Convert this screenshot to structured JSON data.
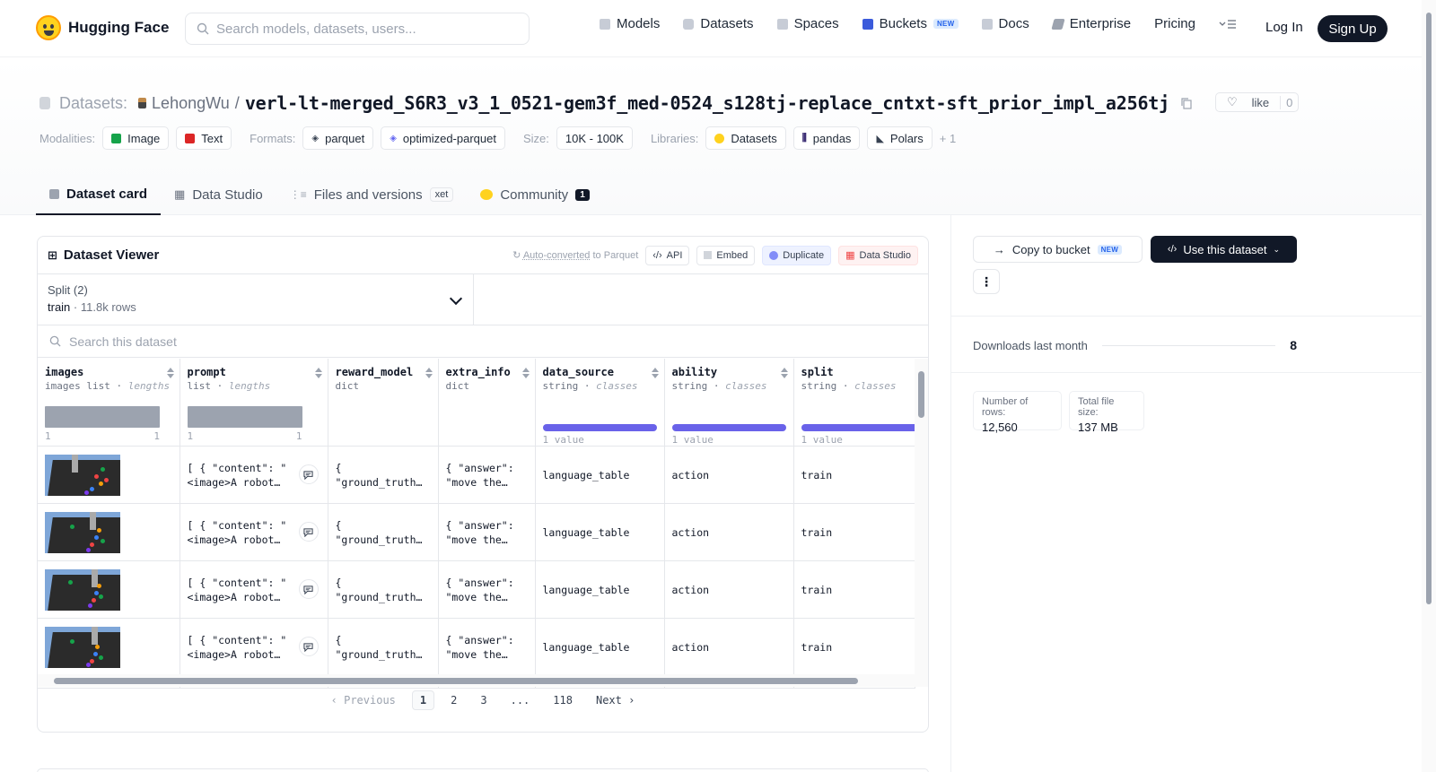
{
  "nav": {
    "brand": "Hugging Face",
    "search_placeholder": "Search models, datasets, users...",
    "links": [
      {
        "label": "Models",
        "icon": "models-icon"
      },
      {
        "label": "Datasets",
        "icon": "datasets-icon"
      },
      {
        "label": "Spaces",
        "icon": "spaces-icon"
      },
      {
        "label": "Buckets",
        "icon": "buckets-icon",
        "badge": "NEW"
      },
      {
        "label": "Docs",
        "icon": "docs-icon"
      },
      {
        "label": "Enterprise",
        "icon": "enterprise-icon"
      },
      {
        "label": "Pricing"
      }
    ],
    "login": "Log In",
    "signup": "Sign Up"
  },
  "dataset": {
    "section_label": "Datasets:",
    "owner": "LehongWu",
    "separator": "/",
    "name": "verl-lt-merged_S6R3_v3_1_0521-gem3f_med-0524_s128tj-replace_cntxt-sft_prior_impl_a256tj",
    "like_label": "like",
    "like_count": "0"
  },
  "meta": {
    "modalities_label": "Modalities:",
    "modalities": [
      "Image",
      "Text"
    ],
    "formats_label": "Formats:",
    "formats": [
      "parquet",
      "optimized-parquet"
    ],
    "size_label": "Size:",
    "size": "10K - 100K",
    "libraries_label": "Libraries:",
    "libraries": [
      "Datasets",
      "pandas",
      "Polars"
    ],
    "libraries_more": "+ 1"
  },
  "tabs": [
    {
      "label": "Dataset card",
      "active": true
    },
    {
      "label": "Data Studio"
    },
    {
      "label": "Files and versions",
      "badge": "xet"
    },
    {
      "label": "Community",
      "count": "1"
    }
  ],
  "viewer": {
    "title": "Dataset Viewer",
    "auto_converted_link": "Auto-converted",
    "auto_converted_rest": "to Parquet",
    "api": "API",
    "embed": "Embed",
    "duplicate": "Duplicate",
    "data_studio": "Data Studio",
    "split_label": "Split (2)",
    "split_value": "train",
    "split_rows": "11.8k rows",
    "search_placeholder": "Search this dataset",
    "columns": [
      {
        "name": "images",
        "type": "images list",
        "sub": "lengths",
        "hist_min": "1",
        "hist_max": "1"
      },
      {
        "name": "prompt",
        "type": "list",
        "sub": "lengths",
        "hist_min": "1",
        "hist_max": "1"
      },
      {
        "name": "reward_model",
        "type": "dict"
      },
      {
        "name": "extra_info",
        "type": "dict"
      },
      {
        "name": "data_source",
        "type": "string",
        "sub": "classes",
        "class_label": "1 value"
      },
      {
        "name": "ability",
        "type": "string",
        "sub": "classes",
        "class_label": "1 value"
      },
      {
        "name": "split",
        "type": "string",
        "sub": "classes",
        "class_label": "1 value"
      }
    ],
    "rows": [
      {
        "prompt": "[ { \"content\": \"\n<image>A robot…",
        "reward_model": "{\n\"ground_truth…",
        "extra_info": "{ \"answer\":\n\"move the…",
        "data_source": "language_table",
        "ability": "action",
        "split": "train"
      },
      {
        "prompt": "[ { \"content\": \"\n<image>A robot…",
        "reward_model": "{\n\"ground_truth…",
        "extra_info": "{ \"answer\":\n\"move the…",
        "data_source": "language_table",
        "ability": "action",
        "split": "train"
      },
      {
        "prompt": "[ { \"content\": \"\n<image>A robot…",
        "reward_model": "{\n\"ground_truth…",
        "extra_info": "{ \"answer\":\n\"move the…",
        "data_source": "language_table",
        "ability": "action",
        "split": "train"
      },
      {
        "prompt": "[ { \"content\": \"\n<image>A robot…",
        "reward_model": "{\n\"ground_truth…",
        "extra_info": "{ \"answer\":\n\"move the…",
        "data_source": "language_table",
        "ability": "action",
        "split": "train"
      }
    ],
    "pager": {
      "previous": "Previous",
      "pages": [
        "1",
        "2",
        "3",
        "...",
        "118"
      ],
      "next": "Next"
    }
  },
  "sidebar": {
    "copy_to_bucket": "Copy to bucket",
    "copy_badge": "NEW",
    "use_dataset": "Use this dataset",
    "downloads_label": "Downloads last month",
    "downloads_value": "8",
    "stats": [
      {
        "label": "Number of rows:",
        "value": "12,560"
      },
      {
        "label": "Total file size:",
        "value": "137 MB"
      }
    ]
  },
  "colors": {
    "accent_dark": "#111827",
    "class_bar": "#4f46e5",
    "hist_bar": "#9ca3af"
  }
}
